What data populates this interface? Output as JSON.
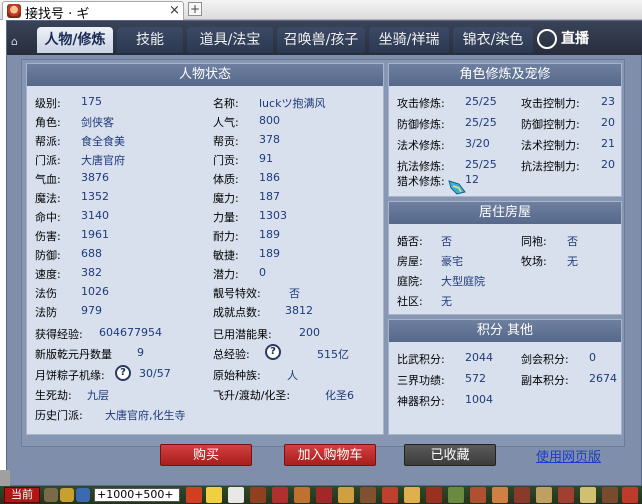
{
  "browser": {
    "tab_title": "接找号 · ギ",
    "tab_close": "×",
    "new_tab": "+"
  },
  "window": {
    "tabs": [
      "人物/修炼",
      "技能",
      "道具/法宝",
      "召唤兽/孩子",
      "坐骑/祥瑞",
      "锦衣/染色"
    ],
    "active_tab": "人物/修炼",
    "brand_text": "直播"
  },
  "character": {
    "header": "人物状态",
    "left": [
      {
        "label": "级别:",
        "value": "175"
      },
      {
        "label": "角色:",
        "value": "剑侠客"
      },
      {
        "label": "帮派:",
        "value": "食全食美"
      },
      {
        "label": "门派:",
        "value": "大唐官府"
      },
      {
        "label": "气血:",
        "value": "3876"
      },
      {
        "label": "魔法:",
        "value": "1352"
      },
      {
        "label": "命中:",
        "value": "3140"
      },
      {
        "label": "伤害:",
        "value": "1961"
      },
      {
        "label": "防御:",
        "value": "688"
      },
      {
        "label": "速度:",
        "value": "382"
      },
      {
        "label": "法伤",
        "value": "1026"
      },
      {
        "label": "法防",
        "value": "979"
      }
    ],
    "right": [
      {
        "label": "名称:",
        "value": "luckツ抱满风"
      },
      {
        "label": "人气:",
        "value": "800"
      },
      {
        "label": "帮贡:",
        "value": "378"
      },
      {
        "label": "门贡:",
        "value": "91"
      },
      {
        "label": "体质:",
        "value": "186"
      },
      {
        "label": "魔力:",
        "value": "187"
      },
      {
        "label": "力量:",
        "value": "1303"
      },
      {
        "label": "耐力:",
        "value": "189"
      },
      {
        "label": "敏捷:",
        "value": "189"
      },
      {
        "label": "潜力:",
        "value": "0"
      },
      {
        "label": "靓号特效:",
        "value": "否"
      },
      {
        "label": "成就点数:",
        "value": "3812"
      }
    ],
    "exp_label": "获得经验:",
    "exp_value": "604677954",
    "used_potential_label": "已用潜能果:",
    "used_potential_value": "200",
    "qiankun_label": "新版乾元丹数量",
    "qiankun_value": "9",
    "total_exp_label": "总经验:",
    "total_exp_value": "515亿",
    "mooncake_label": "月饼粽子机缘:",
    "mooncake_value": "30/57",
    "origin_race_label": "原始种族:",
    "origin_race_value": "人",
    "life_death_label": "生死劫:",
    "life_death_value": "九层",
    "ascend_label": "飞升/渡劫/化圣:",
    "ascend_value": "化圣6",
    "history_label": "历史门派:",
    "history_value": "大唐官府,化生寺",
    "qmark": "?"
  },
  "cultivation": {
    "header": "角色修炼及宠修",
    "rows": [
      {
        "l1": "攻击修炼:",
        "v1": "25/25",
        "l2": "攻击控制力:",
        "v2": "23"
      },
      {
        "l1": "防御修炼:",
        "v1": "25/25",
        "l2": "防御控制力:",
        "v2": "20"
      },
      {
        "l1": "法术修炼:",
        "v1": "3/20",
        "l2": "法术控制力:",
        "v2": "21"
      },
      {
        "l1": "抗法修炼:",
        "v1": "25/25",
        "l2": "抗法控制力:",
        "v2": "20"
      }
    ],
    "hunt_label": "猎术修炼:",
    "hunt_value": "12"
  },
  "housing": {
    "header": "居住房屋",
    "married_label": "婚否:",
    "married_value": "否",
    "robe_label": "同袍:",
    "robe_value": "否",
    "house_label": "房屋:",
    "house_value": "豪宅",
    "ranch_label": "牧场:",
    "ranch_value": "无",
    "yard_label": "庭院:",
    "yard_value": "大型庭院",
    "community_label": "社区:",
    "community_value": "无"
  },
  "points": {
    "header": "积分 其他",
    "pvp_label": "比武积分:",
    "pvp_value": "2044",
    "sword_label": "剑会积分:",
    "sword_value": "0",
    "merit_label": "三界功绩:",
    "merit_value": "572",
    "dungeon_label": "副本积分:",
    "dungeon_value": "2674",
    "artifact_label": "神器积分:",
    "artifact_value": "1004"
  },
  "actions": {
    "buy": "购买",
    "add_cart": "加入购物车",
    "favorited": "已收藏",
    "web_version": "使用网页版"
  },
  "statusbar": {
    "now": "当前",
    "chat_text": "+1000+500+"
  },
  "colors": {
    "accent_blue": "#1f3a7a",
    "buy_red": "#c02c2c",
    "window_bg": "#8796b3",
    "panel_bg": "#d8e0ee"
  }
}
